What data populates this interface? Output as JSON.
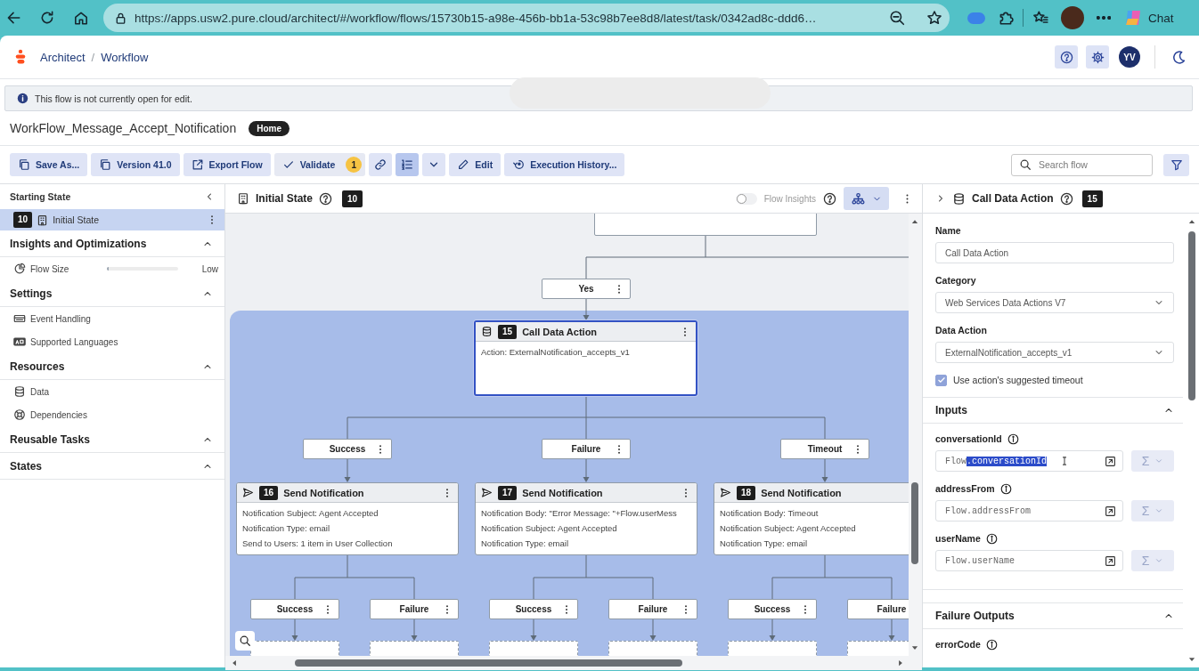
{
  "browser": {
    "url": "https://apps.usw2.pure.cloud/architect/#/workflow/flows/15730b15-a98e-456b-bb1a-53c98b7ee8d8/latest/task/0342ad8c-ddd6…",
    "chat_label": "Chat"
  },
  "header": {
    "breadcrumbs": [
      {
        "label": "Architect"
      },
      {
        "label": "Workflow"
      }
    ],
    "separator": "/",
    "avatar_initials": "YV"
  },
  "banner": {
    "message": "This flow is not currently open for edit."
  },
  "flow": {
    "name": "WorkFlow_Message_Accept_Notification",
    "tag": "Home"
  },
  "toolbar": {
    "buttons": [
      {
        "kind": "save_as",
        "label": "Save As...",
        "selected": false
      },
      {
        "kind": "version",
        "label": "Version 41.0",
        "selected": false
      },
      {
        "kind": "export",
        "label": "Export Flow",
        "selected": false
      },
      {
        "kind": "validate",
        "label": "Validate",
        "count": "1",
        "selected": false
      },
      {
        "kind": "link",
        "selected": false
      },
      {
        "kind": "outline",
        "selected": true
      },
      {
        "kind": "caret",
        "selected": false
      },
      {
        "kind": "edit",
        "label": "Edit",
        "selected": false
      },
      {
        "kind": "history",
        "label": "Execution History...",
        "selected": false
      }
    ],
    "search": {
      "placeholder": "Search flow"
    }
  },
  "sidebar": {
    "title": "Starting State",
    "starting_item": {
      "number": "10",
      "label": "Initial State",
      "selected": true
    },
    "sections": [
      {
        "title": "Insights and Optimizations",
        "expanded": true,
        "items": [
          {
            "kind": "meter",
            "label": "Flow Size",
            "level": 0.03,
            "reading": "Low"
          }
        ]
      },
      {
        "title": "Settings",
        "expanded": true,
        "items": [
          {
            "kind": "events",
            "label": "Event Handling"
          },
          {
            "kind": "languages",
            "label": "Supported Languages"
          }
        ]
      },
      {
        "title": "Resources",
        "expanded": true,
        "items": [
          {
            "kind": "data",
            "label": "Data"
          },
          {
            "kind": "dependencies",
            "label": "Dependencies"
          }
        ]
      },
      {
        "title": "Reusable Tasks",
        "expanded": true
      },
      {
        "title": "States",
        "expanded": true
      }
    ]
  },
  "canvas": {
    "title": "Initial State",
    "number": "10",
    "insights": {
      "label": "Flow Insights",
      "on": false
    },
    "nodes": [
      {
        "kind": "block"
      },
      {
        "kind": "path",
        "label": "Yes"
      },
      {
        "kind": "data_action",
        "number": "15",
        "title": "Call Data Action",
        "details": [
          "Action: ExternalNotification_accepts_v1"
        ],
        "selected": true
      },
      {
        "kind": "path",
        "label": "Success"
      },
      {
        "kind": "path",
        "label": "Failure"
      },
      {
        "kind": "path",
        "label": "Timeout"
      },
      {
        "kind": "notification",
        "number": "16",
        "title": "Send Notification",
        "details": [
          "Notification Subject: Agent Accepted",
          "Notification Type: email",
          "Send to Users: 1 item in User Collection"
        ],
        "selected": false
      },
      {
        "kind": "notification",
        "number": "17",
        "title": "Send Notification",
        "details": [
          "Notification Body: \"Error Message: \"+Flow.userMess",
          "Notification Subject: Agent Accepted",
          "Notification Type: email"
        ],
        "selected": false
      },
      {
        "kind": "notification",
        "number": "18",
        "title": "Send Notification",
        "details": [
          "Notification Body: Timeout",
          "Notification Subject: Agent Accepted",
          "Notification Type: email"
        ],
        "selected": false
      },
      {
        "kind": "path",
        "label": "Success"
      },
      {
        "kind": "path",
        "label": "Failure"
      },
      {
        "kind": "path",
        "label": "Success"
      },
      {
        "kind": "path",
        "label": "Failure"
      },
      {
        "kind": "path",
        "label": "Success"
      },
      {
        "kind": "path",
        "label": "Failure"
      },
      {
        "kind": "placeholder"
      },
      {
        "kind": "placeholder"
      },
      {
        "kind": "placeholder"
      },
      {
        "kind": "placeholder"
      },
      {
        "kind": "placeholder"
      },
      {
        "kind": "placeholder"
      }
    ]
  },
  "panel": {
    "title": "Call Data Action",
    "number": "15",
    "fields": [
      {
        "kind": "text",
        "label": "Name",
        "value": "Call Data Action"
      },
      {
        "kind": "select",
        "label": "Category",
        "value": "Web Services Data Actions V7"
      },
      {
        "kind": "select",
        "label": "Data Action",
        "value": "ExternalNotification_accepts_v1"
      }
    ],
    "timeout_checkbox": {
      "label": "Use action's suggested timeout",
      "checked": true
    },
    "sections": [
      {
        "title": "Inputs",
        "expanded": true,
        "inputs": [
          {
            "name": "conversationId",
            "value_parts": [
              {
                "text": "Flow",
                "selected": false
              },
              {
                "text": ".conversationId",
                "selected": true
              }
            ],
            "expression_symbol": "Σ"
          },
          {
            "name": "addressFrom",
            "value_parts": [
              {
                "text": "Flow.addressFrom",
                "selected": false
              }
            ],
            "expression_symbol": "Σ"
          },
          {
            "name": "userName",
            "value_parts": [
              {
                "text": "Flow.userName",
                "selected": false
              }
            ],
            "expression_symbol": "Σ"
          }
        ]
      },
      {
        "title": "Failure Outputs",
        "expanded": true,
        "inputs": [
          {
            "name": "errorCode"
          }
        ]
      }
    ]
  }
}
